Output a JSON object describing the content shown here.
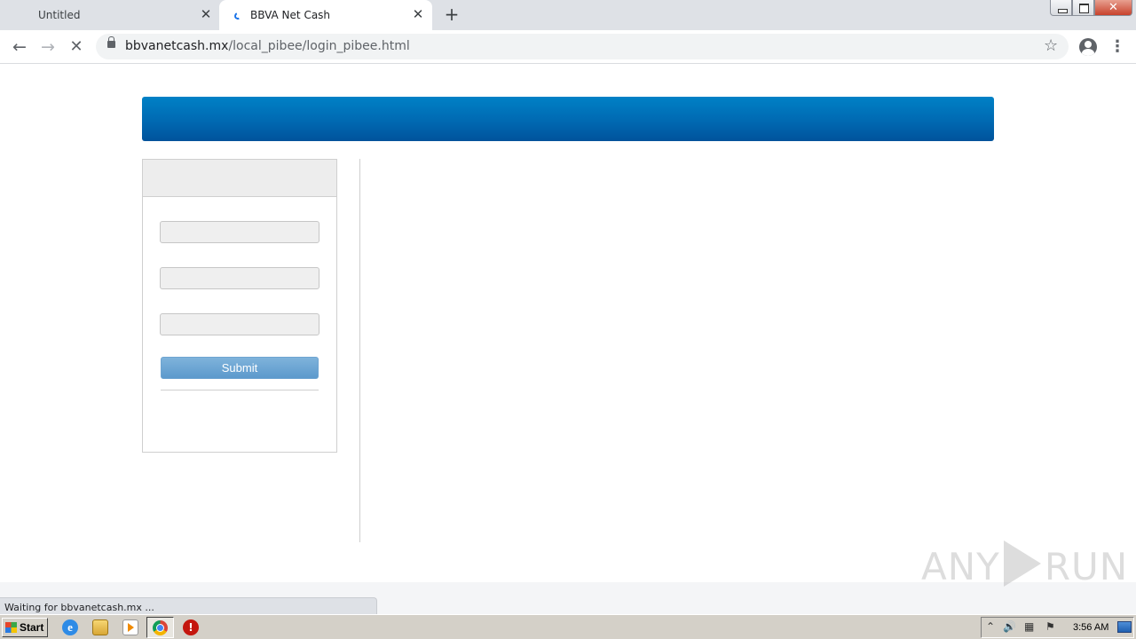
{
  "browser": {
    "tabs": [
      {
        "title": "Untitled",
        "active": false
      },
      {
        "title": "BBVA Net Cash",
        "active": true,
        "loading": true
      }
    ],
    "new_tab_label": "+",
    "close_glyph": "✕",
    "url_domain": "bbvanetcash.mx",
    "url_path": "/local_pibee/login_pibee.html",
    "status_text": "Waiting for bbvanetcash.mx ...",
    "window_close_glyph": "✕"
  },
  "page": {
    "banner_color": "#0072bb",
    "login_fields": [
      {
        "name": "field-1",
        "value": ""
      },
      {
        "name": "field-2",
        "value": ""
      },
      {
        "name": "field-3",
        "value": ""
      }
    ],
    "submit_label": "Submit",
    "submit_color": "#6aa6d6"
  },
  "watermark": {
    "left_text": "ANY",
    "right_text": "RUN"
  },
  "taskbar": {
    "start_label": "Start",
    "clock": "3:56 AM",
    "pinned": [
      "ie-icon",
      "explorer-folder-icon",
      "media-player-icon",
      "chrome-icon",
      "stop-icon"
    ]
  }
}
